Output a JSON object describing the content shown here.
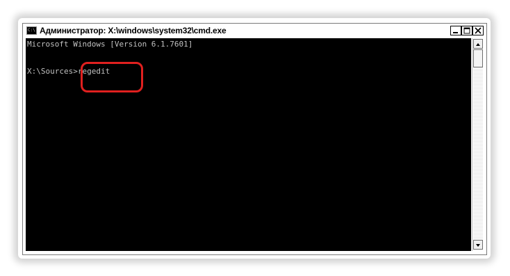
{
  "window": {
    "title": "Администратор: X:\\windows\\system32\\cmd.exe",
    "icon": "cmd-icon",
    "icon_text": "C:\\",
    "controls": {
      "minimize": "minimize-icon",
      "maximize": "maximize-icon",
      "close": "close-icon"
    }
  },
  "console": {
    "lines": [
      "Microsoft Windows [Version 6.1.7601]",
      "",
      "X:\\Sources>regedit"
    ],
    "text_color": "#c0c0c0",
    "background_color": "#000000"
  },
  "annotation": {
    "highlight_color": "#e0201f",
    "highlighted_text": "regedit"
  },
  "scrollbar": {
    "up": "arrow-up-icon",
    "down": "arrow-down-icon"
  }
}
